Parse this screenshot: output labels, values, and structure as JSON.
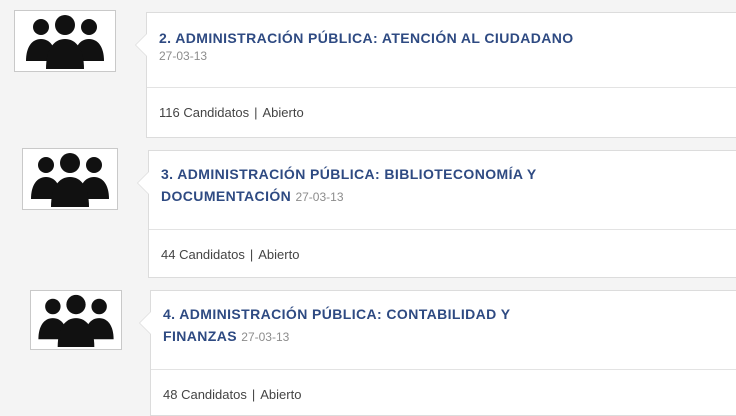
{
  "listings": [
    {
      "title": "2. ADMINISTRACIÓN PÚBLICA: ATENCIÓN AL CIUDADANO",
      "date": "27-03-13",
      "candidates": "116 Candidatos",
      "separator": "|",
      "status": "Abierto",
      "icon": "group-icon"
    },
    {
      "title": "3. ADMINISTRACIÓN PÚBLICA: BIBLIOTECONOMÍA Y DOCUMENTACIÓN",
      "date": "27-03-13",
      "candidates": "44 Candidatos",
      "separator": "|",
      "status": "Abierto",
      "icon": "group-icon"
    },
    {
      "title": "4. ADMINISTRACIÓN PÚBLICA: CONTABILIDAD Y FINANZAS",
      "date": "27-03-13",
      "candidates": "48 Candidatos",
      "separator": "|",
      "status": "Abierto",
      "icon": "group-icon"
    }
  ],
  "colors": {
    "title": "#2e4a82",
    "date": "#8c8c8c",
    "meta": "#444444"
  }
}
